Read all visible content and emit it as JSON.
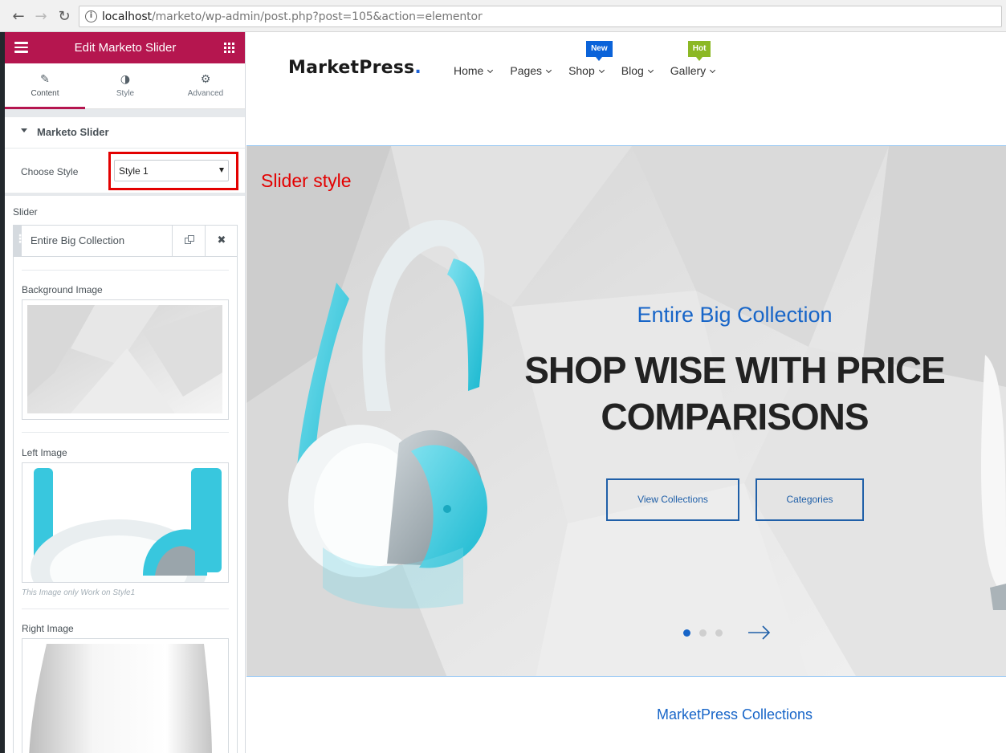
{
  "browser": {
    "back_icon": "←",
    "forward_icon": "→",
    "reload_icon": "↻",
    "info_icon": "i",
    "url_host": "localhost",
    "url_path": "/marketo/wp-admin/post.php?post=105&action=elementor"
  },
  "panel": {
    "title": "Edit Marketo Slider",
    "accent_color": "#b5164f",
    "tabs": [
      {
        "label": "Content",
        "icon": "✎"
      },
      {
        "label": "Style",
        "icon": "◑"
      },
      {
        "label": "Advanced",
        "icon": "⚙"
      }
    ],
    "section_title": "Marketo Slider",
    "choose_style_label": "Choose Style",
    "choose_style_value": "Style 1",
    "slider_label": "Slider",
    "repeater_item_title": "Entire Big Collection",
    "delete_icon": "✖",
    "background_image_label": "Background Image",
    "left_image_label": "Left Image",
    "left_image_note": "This Image only Work on Style1",
    "right_image_label": "Right Image",
    "toggle_icon": "‹"
  },
  "site": {
    "logo_text": "MarketPress",
    "logo_dot": ".",
    "menu": [
      {
        "label": "Home",
        "badge": ""
      },
      {
        "label": "Pages",
        "badge": ""
      },
      {
        "label": "Shop",
        "badge": "New"
      },
      {
        "label": "Blog",
        "badge": ""
      },
      {
        "label": "Gallery",
        "badge": "Hot"
      }
    ],
    "slider": {
      "annotation": "Slider style",
      "subtitle": "Entire Big Collection",
      "heading_line1": "SHOP WISE WITH PRICE",
      "heading_line2": "COMPARISONS",
      "button_view": "View Collections",
      "button_categories": "Categories",
      "active_dot": 1,
      "dot_count": 3
    },
    "collections_heading": "MarketPress Collections"
  }
}
